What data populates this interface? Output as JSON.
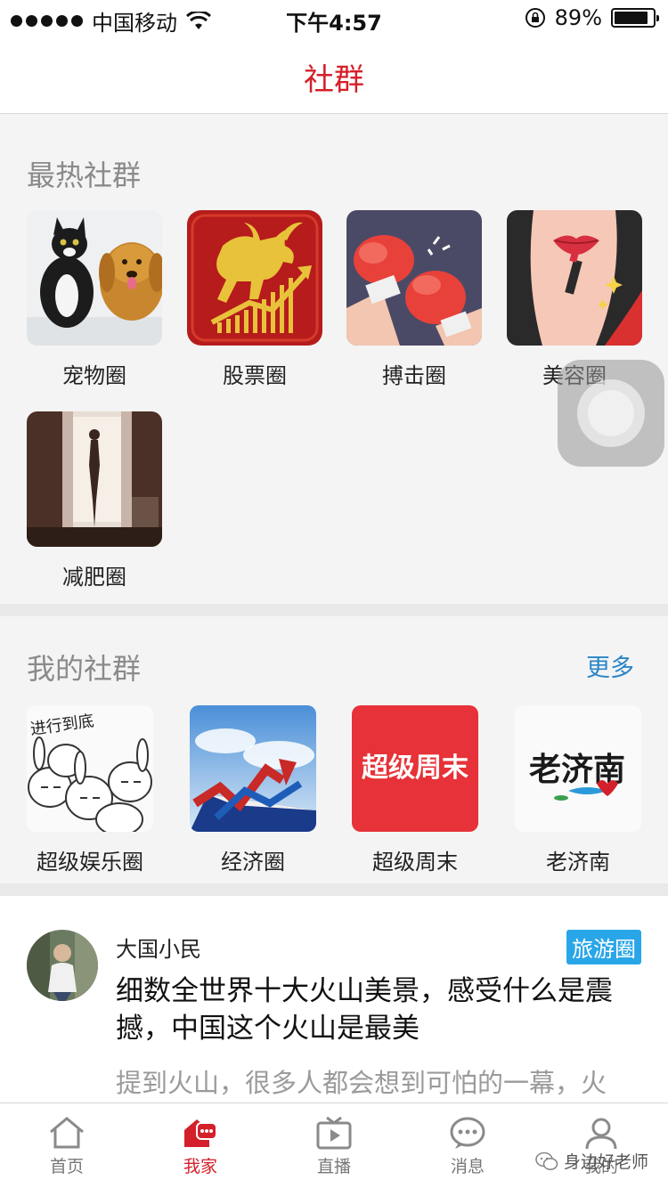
{
  "status_bar": {
    "carrier": "中国移动",
    "time": "下午4:57",
    "battery": "89%",
    "battery_level": 0.89
  },
  "nav": {
    "title": "社群"
  },
  "hot_section": {
    "title": "最热社群",
    "items": [
      {
        "label": "宠物圈",
        "image": "pet-photo"
      },
      {
        "label": "股票圈",
        "image": "bull-icon"
      },
      {
        "label": "搏击圈",
        "image": "boxing-glove-icon"
      },
      {
        "label": "美容圈",
        "image": "lipstick-illustration"
      },
      {
        "label": "减肥圈",
        "image": "silhouette-photo"
      }
    ]
  },
  "my_section": {
    "title": "我的社群",
    "more": "更多",
    "items": [
      {
        "label": "超级娱乐圈",
        "image": "rabbits-cartoon",
        "image_text": "进行到底"
      },
      {
        "label": "经济圈",
        "image": "rising-chart-photo"
      },
      {
        "label": "超级周末",
        "image": "weekend-logo",
        "image_text": "超级周末"
      },
      {
        "label": "老济南",
        "image": "old-jinan-calligraphy",
        "image_text": "老济南"
      }
    ]
  },
  "post": {
    "author": "大国小民",
    "tag": "旅游圈",
    "title": "细数全世界十大火山美景，感受什么是震撼，中国这个火山是最美",
    "excerpt": "提到火山，很多人都会想到可怕的一幕，火"
  },
  "tab_bar": {
    "tabs": [
      {
        "label": "首页",
        "icon": "home-icon"
      },
      {
        "label": "我家",
        "icon": "my-home-icon",
        "active": true
      },
      {
        "label": "直播",
        "icon": "tv-icon"
      },
      {
        "label": "消息",
        "icon": "message-icon"
      },
      {
        "label": "我的",
        "icon": "person-icon"
      }
    ]
  },
  "watermark": "身边好老师",
  "colors": {
    "brand_red": "#d4202a",
    "link_blue": "#2a86c8",
    "tag_blue": "#29a6e8"
  }
}
